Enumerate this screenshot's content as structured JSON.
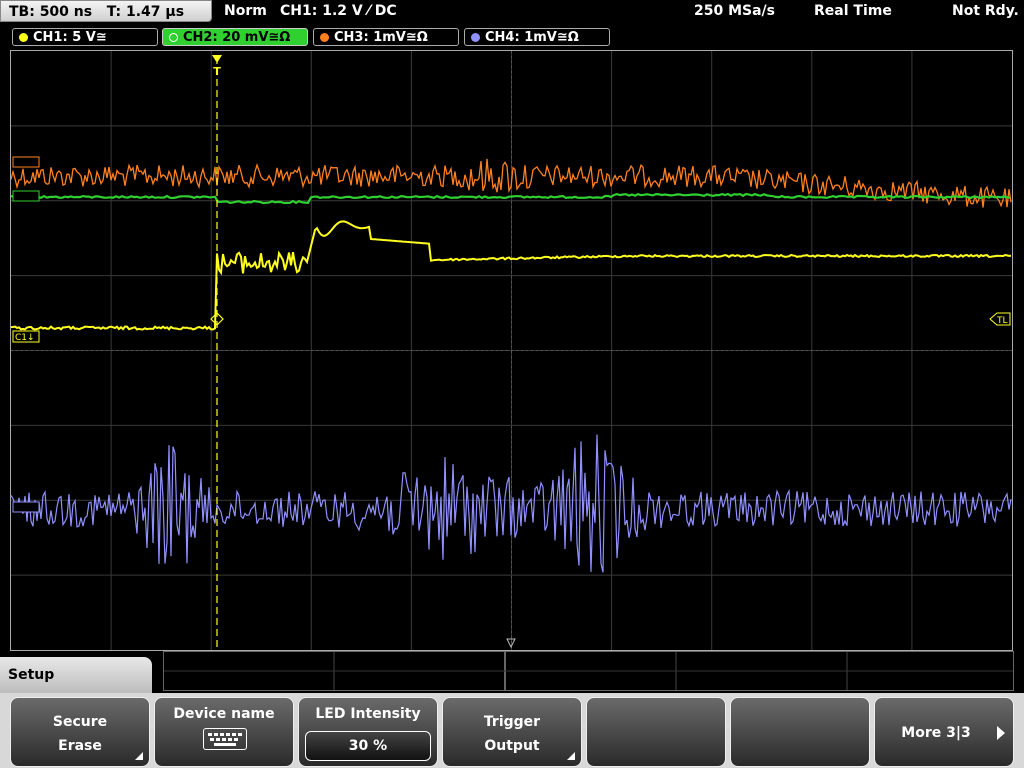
{
  "status_bar": {
    "tb": "TB: 500 ns",
    "t": "T: 1.47 µs",
    "trigger_mode": "Norm",
    "trigger_info": "CH1: 1.2 V ⁄ DC",
    "sample_rate": "250 MSa/s",
    "acq_mode": "Real Time",
    "status": "Not Rdy."
  },
  "channels": [
    {
      "label": "CH1: 5 V≅",
      "color": "#ffff20",
      "active": false
    },
    {
      "label": "CH2: 20 mV≅Ω",
      "color": "#30d030",
      "active": true
    },
    {
      "label": "CH3: 1mV≅Ω",
      "color": "#ff8020",
      "active": false
    },
    {
      "label": "CH4: 1mV≅Ω",
      "color": "#9090ff",
      "active": false
    }
  ],
  "markers": {
    "c1": "C1↓",
    "tl": "TL",
    "trigger": "T"
  },
  "menu": {
    "title": "Setup",
    "softkeys": [
      {
        "line1": "Secure",
        "line2": "Erase"
      },
      {
        "line1": "Device name"
      },
      {
        "line1": "LED Intensity",
        "value": "30 %"
      },
      {
        "line1": "Trigger",
        "line2": "Output"
      },
      {
        "line1": ""
      },
      {
        "line1": ""
      },
      {
        "line1": "More 3|3"
      }
    ]
  },
  "colors": {
    "ch1": "#ffff20",
    "ch2": "#30d030",
    "ch3": "#ff8020",
    "ch4": "#9090ff",
    "grid": "#5a5a5a"
  }
}
